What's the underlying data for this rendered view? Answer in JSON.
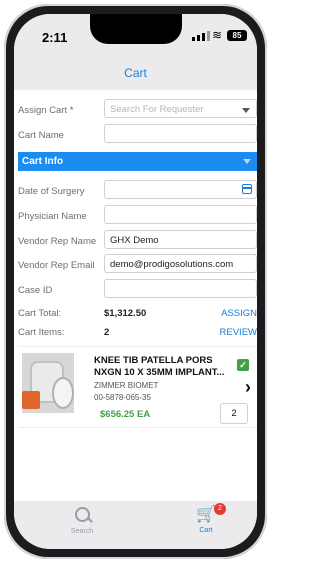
{
  "status": {
    "time": "2:11",
    "battery": "85"
  },
  "nav": {
    "title": "Cart"
  },
  "form": {
    "assign_label": "Assign Cart",
    "assign_required": "*",
    "assign_placeholder": "Search For Requester",
    "cart_name_label": "Cart Name",
    "cart_name_value": ""
  },
  "section": {
    "title": "Cart Info"
  },
  "info": {
    "surgery_label": "Date of Surgery",
    "surgery_value": "",
    "physician_label": "Physician Name",
    "physician_value": "",
    "rep_name_label": "Vendor Rep Name",
    "rep_name_value": "GHX Demo",
    "rep_email_label": "Vendor Rep Email",
    "rep_email_value": "demo@prodigosolutions.com",
    "case_label": "Case ID",
    "case_value": "",
    "total_label": "Cart Total:",
    "total_value": "$1,312.50",
    "assign_link": "ASSIGN",
    "items_label": "Cart Items:",
    "items_value": "2",
    "review_link": "REVIEW"
  },
  "item": {
    "name": "KNEE TIB PATELLA PORS NXGN 10 X 35MM IMPLANT...",
    "manufacturer": "ZIMMER BIOMET",
    "part_number": "00-5878-065-35",
    "price": "$656.25 EA",
    "quantity": "2",
    "check_glyph": "✓",
    "chevron_glyph": "›"
  },
  "tabs": {
    "search": "Search",
    "cart": "Cart",
    "cart_badge": "2"
  },
  "colors": {
    "accent": "#1a8cf2",
    "link": "#1a7fd4",
    "price": "#43a047",
    "badge": "#e53935"
  }
}
